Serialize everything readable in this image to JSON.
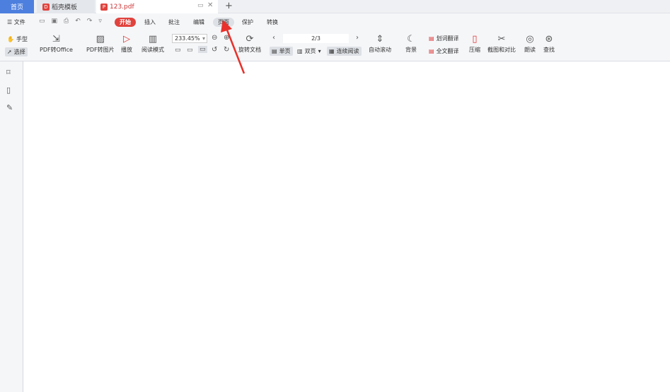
{
  "tabs": {
    "home": "首页",
    "template": "稻壳模板",
    "pdf": "123.pdf",
    "new_tab": "+"
  },
  "menu": {
    "file": "文件",
    "items": [
      "开始",
      "插入",
      "批注",
      "编辑",
      "页面",
      "保护",
      "转换"
    ]
  },
  "ribbon": {
    "hand": "手型",
    "select": "选择",
    "pdf_to_office": "PDF转Office",
    "pdf_to_image": "PDF转图片",
    "play": "播放",
    "read_mode": "阅读模式",
    "zoom": "233.45%",
    "rotate": "旋转文档",
    "page_indicator": "2/3",
    "single_page": "单页",
    "double_page": "双页",
    "continuous": "连续阅读",
    "auto_scroll": "自动滚动",
    "background": "背景",
    "word_translate": "划词翻译",
    "full_translate": "全文翻译",
    "compress": "压缩",
    "screenshot_compare": "截图和对比",
    "read_aloud": "朗读",
    "find": "查找"
  },
  "colors": {
    "accent_red": "#e0433d",
    "home_tab_blue": "#4d7fde"
  }
}
